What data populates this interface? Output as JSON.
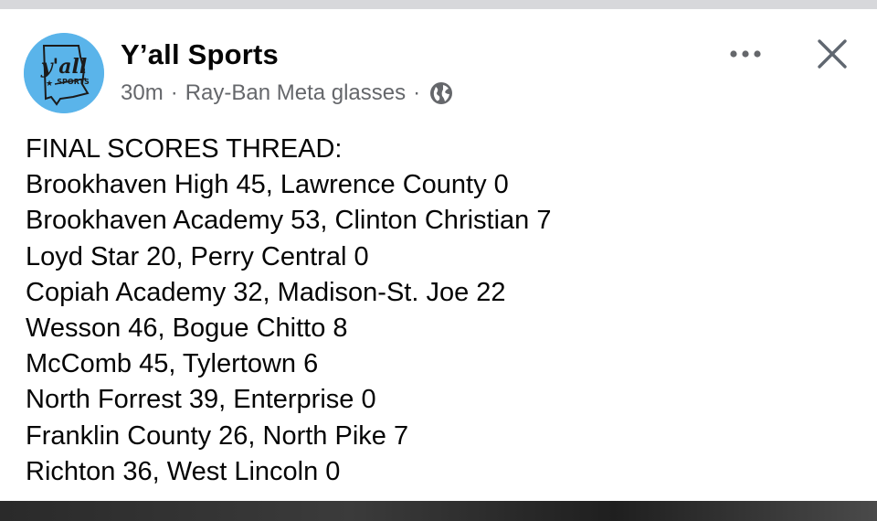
{
  "post": {
    "page_name": "Y’all Sports",
    "time": "30m",
    "via": "Ray-Ban Meta glasses",
    "separator": "·",
    "privacy_icon": "globe-icon",
    "avatar": {
      "logo_text": "y'all",
      "logo_subtext": "SPORTS",
      "background": "#5ab4ea"
    },
    "actions": {
      "more_icon": "more-horizontal-icon",
      "close_icon": "close-icon"
    },
    "lines": [
      "FINAL SCORES THREAD:",
      "Brookhaven High 45, Lawrence County 0",
      "Brookhaven Academy 53, Clinton Christian 7",
      "Loyd Star 20, Perry Central 0",
      "Copiah Academy 32, Madison-St. Joe 22",
      "Wesson 46, Bogue Chitto 8",
      "McComb 45, Tylertown 6",
      "North Forrest 39, Enterprise 0",
      "Franklin County 26, North Pike 7",
      "Richton 36, West Lincoln 0"
    ]
  }
}
